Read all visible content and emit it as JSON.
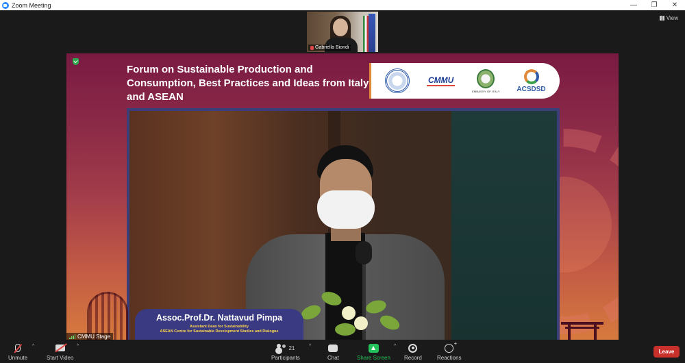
{
  "window": {
    "title": "Zoom Meeting"
  },
  "thumbnail": {
    "participant_name": "Gabriella Biondi"
  },
  "view_button": {
    "label": "View"
  },
  "slide": {
    "title": "Forum on Sustainable Production and Consumption, Best Practices and Ideas from Italy and ASEAN",
    "logos": {
      "cmmu": "CMMU",
      "embassy_caption": "EMBASSY OF ITALY",
      "acsdsd": "ACSDSD"
    }
  },
  "speaker": {
    "name": "Assoc.Prof.Dr. Nattavud Pimpa",
    "role_line1": "Assistant Dean for Sustainability",
    "role_line2": "ASEAN Centre for Sustainable Development Studies and Dialogue"
  },
  "stage_label": "CMMU Stage",
  "toolbar": {
    "unmute": "Unmute",
    "start_video": "Start Video",
    "participants": "Participants",
    "participants_count": "21",
    "chat": "Chat",
    "share_screen": "Share Screen",
    "record": "Record",
    "reactions": "Reactions",
    "leave": "Leave"
  },
  "colors": {
    "share_green": "#23c25a",
    "leave_red": "#c9302c",
    "speaker_plate": "#3a3a82",
    "speaker_role": "#ffd84a"
  }
}
